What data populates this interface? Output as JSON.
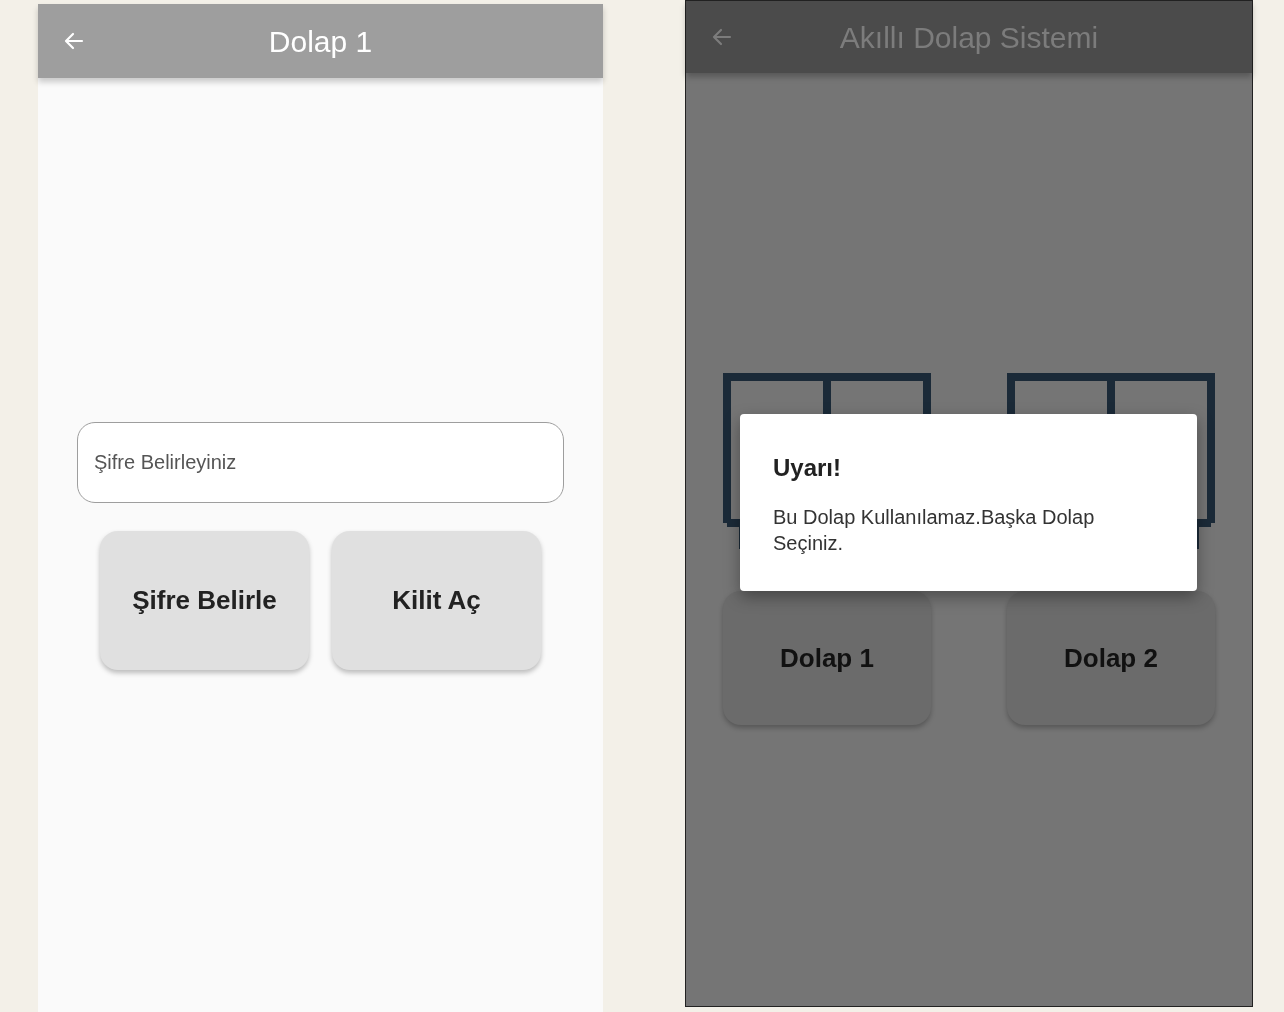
{
  "left_screen": {
    "app_bar": {
      "title": "Dolap 1"
    },
    "password_field": {
      "placeholder": "Şifre Belirleyiniz"
    },
    "buttons": [
      "Şifre Belirle",
      "Kilit Aç"
    ]
  },
  "right_screen": {
    "app_bar": {
      "title": "Akıllı Dolap Sistemi"
    },
    "lockers": [
      {
        "label": "Dolap 1"
      },
      {
        "label": "Dolap 2"
      }
    ],
    "dialog": {
      "title": "Uyarı!",
      "message": "Bu Dolap Kullanılamaz.Başka Dolap Seçiniz."
    }
  }
}
